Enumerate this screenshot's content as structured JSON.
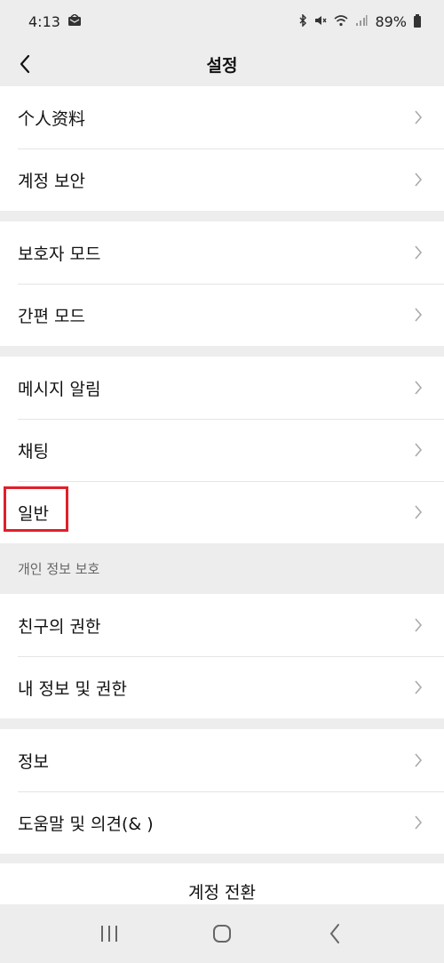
{
  "status_bar": {
    "time": "4:13",
    "battery": "89%",
    "icons": [
      "mail-notification-icon",
      "bluetooth-icon",
      "mute-icon",
      "wifi-icon",
      "signal-icon",
      "battery-icon"
    ]
  },
  "header": {
    "title": "설정",
    "back_icon": "chevron-left-icon"
  },
  "groups": [
    {
      "items": [
        {
          "label": "个人资料"
        },
        {
          "label": "계정 보안"
        }
      ]
    },
    {
      "items": [
        {
          "label": "보호자 모드"
        },
        {
          "label": "간편 모드"
        }
      ]
    },
    {
      "items": [
        {
          "label": "메시지 알림"
        },
        {
          "label": "채팅"
        },
        {
          "label": "일반"
        }
      ]
    }
  ],
  "privacy_section": {
    "title": "개인 정보 보호",
    "items": [
      {
        "label": "친구의 권한"
      },
      {
        "label": "내 정보 및 권한"
      }
    ]
  },
  "info_group": {
    "items": [
      {
        "label": "정보"
      },
      {
        "label": "도움말 및 의견(& )"
      }
    ]
  },
  "switch_account": "계정 전환",
  "highlight_color": "#e0202a",
  "nav": {
    "icons": [
      "recent-apps-icon",
      "home-icon",
      "back-icon"
    ]
  }
}
